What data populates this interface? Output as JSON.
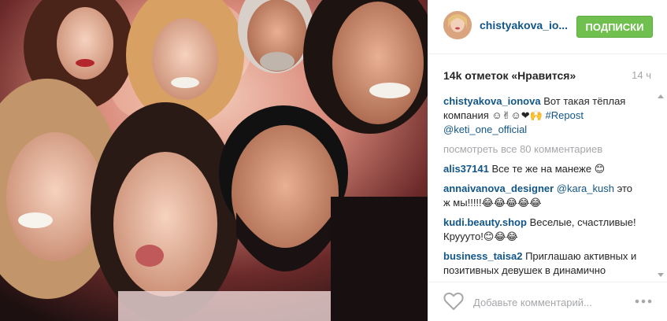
{
  "post": {
    "username": "chistyakova_io...",
    "follow_label": "ПОДПИСКИ",
    "likes": "14k отметок «Нравится»",
    "time_ago": "14 ч"
  },
  "caption": {
    "user": "chistyakova_ionova",
    "text": "Вот такая тёплая компания ☺✌☺❤🙌",
    "tag": "#Repost",
    "mention": "@keti_one_official"
  },
  "view_all_comments": "посмотреть все 80 комментариев",
  "comments": [
    {
      "user": "alis37141",
      "mention": "",
      "text": "Все те же на манеже 😊"
    },
    {
      "user": "annaivanova_designer",
      "mention": "@kara_kush",
      "text": "это ж мы!!!!!😂😂😂😂😂"
    },
    {
      "user": "kudi.beauty.shop",
      "mention": "",
      "text": "Веселые, счастливые! Круууто!😊😂😂"
    },
    {
      "user": "business_taisa2",
      "mention": "",
      "text": "Приглашаю активных и позитивных девушек в динамично развивающийся проект, обучение и"
    }
  ],
  "footer": {
    "comment_placeholder": "Добавьте комментарий...",
    "like_icon": "heart-outline-icon",
    "more_icon": "ellipsis-icon"
  },
  "colors": {
    "username": "#125688",
    "follow_button": "#70c050",
    "muted": "#a5a7aa"
  }
}
